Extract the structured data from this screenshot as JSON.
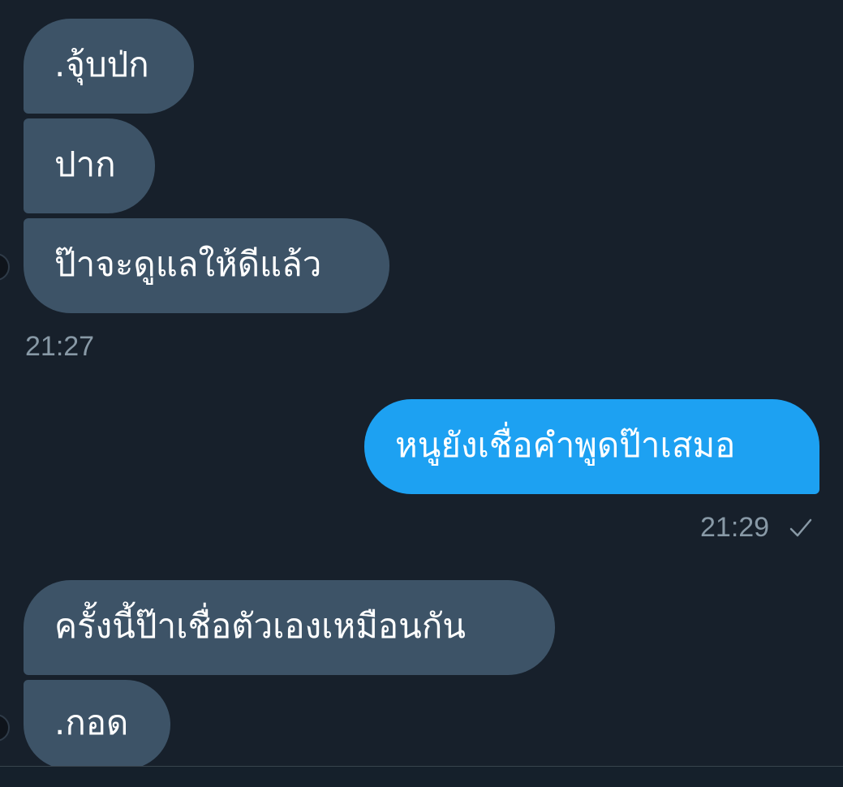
{
  "messages": {
    "m1": ".จุ้บป่ก",
    "m2": "ปาก",
    "m3": "ป๊าจะดูแลให้ดีแล้ว",
    "m3_time": "21:27",
    "m4": "หนูยังเชื่อคำพูดป๊าเสมอ",
    "m4_time": "21:29",
    "m5": "ครั้งนี้ป๊าเชื่อตัวเองเหมือนกัน",
    "m6": ".กอด"
  },
  "icons": {
    "read_receipt": "checkmark-icon",
    "avatar": "avatar"
  },
  "colors": {
    "background": "#17202b",
    "incoming_bubble": "#3d5367",
    "outgoing_bubble": "#1da1f2",
    "timestamp": "#8899a6"
  }
}
